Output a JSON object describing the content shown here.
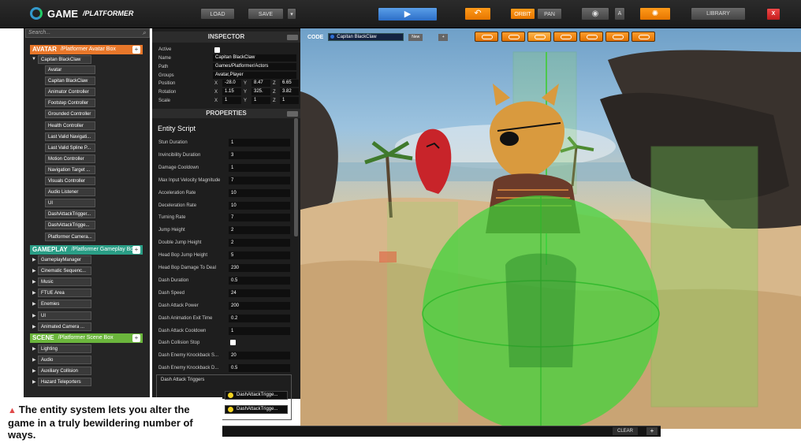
{
  "toolbar": {
    "title": "GAME",
    "subtitle": "/PLATFORMER",
    "load": "LOAD",
    "save": "SAVE",
    "orbit": "ORBIT",
    "pan": "PAN",
    "a": "A",
    "library": "LIBRARY",
    "close": "X",
    "colors": {
      "orange": "#f08a10",
      "blue": "#2c6ec8",
      "red": "#d52525"
    }
  },
  "search": {
    "placeholder": "Search..."
  },
  "tree": {
    "avatar_header": {
      "title": "AVATAR",
      "path": "/Platformer Avatar Box"
    },
    "root_actor": "Capitan BlackClaw",
    "actor_children": [
      "Avatar",
      "Capitan BlackClaw",
      "Animator Controller",
      "Footstep Controller",
      "Grounded Controller",
      "Health Controller",
      "Last Valid Navigati...",
      "Last Valid Spline P...",
      "Motion Controller",
      "Navigation Target ...",
      "Visuals Controller",
      "Audio Listener",
      "UI",
      "DashAttackTrigger...",
      "DashAttackTrigge...",
      "Platformer Camera..."
    ],
    "gameplay_header": {
      "title": "GAMEPLAY",
      "path": "/Platformer Gameplay Box"
    },
    "gameplay_children": [
      "GameplayManager",
      "Cinematic Sequenc...",
      "Music",
      "FTUE Area",
      "Enemies",
      "UI",
      "Animated Camera ..."
    ],
    "scene_header": {
      "title": "SCENE",
      "path": "/Platformer Scene Box"
    },
    "scene_children": [
      "Lighting",
      "Audio",
      "Auxiliary Collision",
      "Hazard Teleporters"
    ]
  },
  "inspector": {
    "title": "INSPECTOR",
    "fields": [
      {
        "label": "Active",
        "value": ""
      },
      {
        "label": "Name",
        "value": "Capitan BlackClaw"
      },
      {
        "label": "Path",
        "value": "Games/Platformer/Actors"
      },
      {
        "label": "Groups",
        "value": "Avatar,Player"
      }
    ],
    "position": {
      "label": "Position",
      "x": "-28.0",
      "y": "8.47",
      "z": "6.65"
    },
    "rotation": {
      "label": "Rotation",
      "x": "1.15",
      "y": "325.",
      "z": "3.82"
    },
    "scale": {
      "label": "Scale",
      "x": "1",
      "y": "1",
      "z": "1"
    },
    "axis": {
      "x": "X",
      "y": "Y",
      "z": "Z"
    }
  },
  "properties": {
    "title": "PROPERTIES",
    "entity": "Entity Script",
    "rows": [
      {
        "label": "Stun Duration",
        "value": "1"
      },
      {
        "label": "Invincibility Duration",
        "value": "3"
      },
      {
        "label": "Damage Cooldown",
        "value": "1"
      },
      {
        "label": "Max Input Velocity Magnitude",
        "value": "7"
      },
      {
        "label": "Acceleration Rate",
        "value": "10"
      },
      {
        "label": "Deceleration Rate",
        "value": "10"
      },
      {
        "label": "Turning Rate",
        "value": "7"
      },
      {
        "label": "Jump Height",
        "value": "2"
      },
      {
        "label": "Double Jump Height",
        "value": "2"
      },
      {
        "label": "Head Bop Jump Height",
        "value": "5"
      },
      {
        "label": "Head Bop Damage To Deal",
        "value": "230"
      },
      {
        "label": "Dash Duration",
        "value": "0.5"
      },
      {
        "label": "Dash Speed",
        "value": "24"
      },
      {
        "label": "Dash Attack Power",
        "value": "200"
      },
      {
        "label": "Dash Animation Exit Time",
        "value": "0.2"
      },
      {
        "label": "Dash Attack Cooldown",
        "value": "1"
      },
      {
        "label": "Dash Collision Stop",
        "value": ""
      },
      {
        "label": "Dash Enemy Knockback S...",
        "value": "20"
      },
      {
        "label": "Dash Enemy Knockback D...",
        "value": "0.5"
      }
    ],
    "triggers_title": "Dash Attack Triggers",
    "triggers": [
      "DashAttackTrigge...",
      "DashAttackTrigge..."
    ]
  },
  "code": {
    "label": "CODE",
    "target": "Capitan BlackClaw",
    "new": "New",
    "plus": "+"
  },
  "console": {
    "clear": "CLEAR",
    "plus": "+"
  },
  "caption": "The entity system lets you alter the game in a truly bewildering number of ways."
}
